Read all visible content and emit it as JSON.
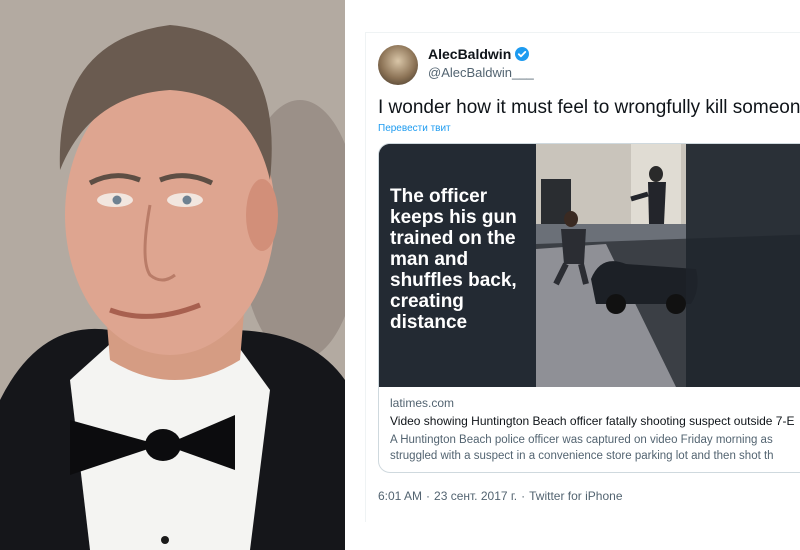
{
  "tweet": {
    "display_name": "AlecBaldwin",
    "handle": "@AlecBaldwin___",
    "text": "I wonder how it must feel to wrongfully kill someone",
    "translate_label": "Перевести твит",
    "card": {
      "image_caption": "The officer keeps his gun trained on the man and shuffles back, creating distance",
      "domain": "latimes.com",
      "title": "Video showing Huntington Beach officer fatally shooting suspect outside 7-E",
      "description_line1": "A Huntington Beach police officer was captured on video Friday morning as",
      "description_line2": "struggled with a suspect in a convenience store parking lot and then shot th"
    },
    "time": "6:01 AM",
    "separator1": "·",
    "date": "23 сент. 2017 г.",
    "separator2": "·",
    "source": "Twitter for iPhone"
  },
  "colors": {
    "link": "#1d9bf0",
    "verified": "#1d9bf0",
    "text_primary": "#0f1419",
    "text_secondary": "#536471"
  }
}
